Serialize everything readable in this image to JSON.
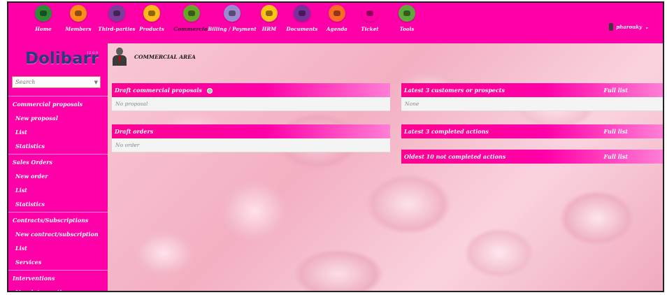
{
  "topmenu": [
    {
      "label": "Home",
      "icon": "home-icon",
      "color": "#2e8b3a",
      "active": false
    },
    {
      "label": "Members",
      "icon": "members-icon",
      "color": "#ff8c1a",
      "active": false
    },
    {
      "label": "Third-parties",
      "icon": "third-parties-icon",
      "color": "#7a3f9a",
      "active": false
    },
    {
      "label": "Products",
      "icon": "products-icon",
      "color": "#ffb91a",
      "active": false
    },
    {
      "label": "Commercial",
      "icon": "commercial-icon",
      "color": "#6aa52a",
      "active": true
    },
    {
      "label": "Billing / Payment",
      "icon": "billing-icon",
      "color": "#9b8ad0",
      "active": false
    },
    {
      "label": "HRM",
      "icon": "hrm-icon",
      "color": "#ffc21a",
      "active": false
    },
    {
      "label": "Documents",
      "icon": "documents-icon",
      "color": "#7a2f9a",
      "active": false
    },
    {
      "label": "Agenda",
      "icon": "agenda-icon",
      "color": "#ff6a2a",
      "active": false
    },
    {
      "label": "Ticket",
      "icon": "ticket-icon",
      "color": "#ff00a8",
      "active": false
    },
    {
      "label": "Tools",
      "icon": "tools-icon",
      "color": "#5fa83a",
      "active": false
    }
  ],
  "user": {
    "name": "pharouky"
  },
  "sidebar": {
    "logo": "Dolibarr",
    "logo_sup": "12.0.0",
    "search_placeholder": "Search",
    "items": [
      {
        "label": "Commercial proposals",
        "type": "head"
      },
      {
        "label": "New proposal",
        "type": "sub"
      },
      {
        "label": "List",
        "type": "sub"
      },
      {
        "label": "Statistics",
        "type": "sub"
      },
      {
        "label": "Sales Orders",
        "type": "head"
      },
      {
        "label": "New order",
        "type": "sub"
      },
      {
        "label": "List",
        "type": "sub"
      },
      {
        "label": "Statistics",
        "type": "sub"
      },
      {
        "label": "Contracts/Subscriptions",
        "type": "head"
      },
      {
        "label": "New contract/subscription",
        "type": "sub"
      },
      {
        "label": "List",
        "type": "sub"
      },
      {
        "label": "Services",
        "type": "sub"
      },
      {
        "label": "Interventions",
        "type": "head"
      },
      {
        "label": "New intervention",
        "type": "sub"
      }
    ]
  },
  "main": {
    "area_title": "COMMERCIAL AREA",
    "boxes": {
      "draft_proposals": {
        "title": "Draft commercial proposals",
        "row": "No proposal"
      },
      "draft_orders": {
        "title": "Draft orders",
        "row": "No order"
      },
      "latest_customers": {
        "title": "Latest 3 customers or prospects",
        "link": "Full list",
        "row": "None"
      },
      "latest_actions": {
        "title": "Latest 3 completed actions",
        "link": "Full list"
      },
      "oldest_actions": {
        "title": "Oldest 10 not completed actions",
        "link": "Full list"
      }
    }
  }
}
